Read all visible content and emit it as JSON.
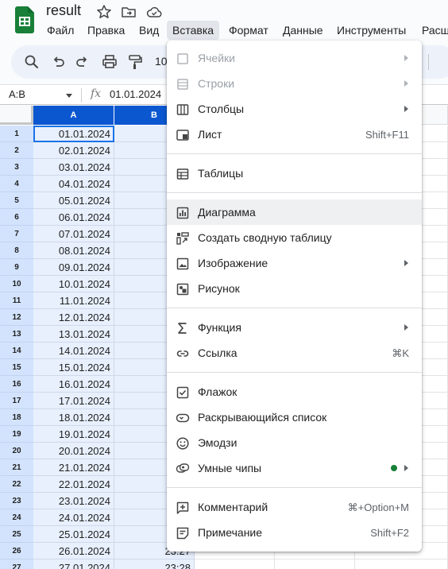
{
  "app": {
    "title": "result",
    "brand_color": "#188038"
  },
  "menubar": {
    "items": [
      {
        "label": "Файл"
      },
      {
        "label": "Правка"
      },
      {
        "label": "Вид"
      },
      {
        "label": "Вставка",
        "active": true
      },
      {
        "label": "Формат"
      },
      {
        "label": "Данные"
      },
      {
        "label": "Инструменты"
      },
      {
        "label": "Расш"
      }
    ]
  },
  "toolbar": {
    "icons": [
      "search-icon",
      "undo-icon",
      "redo-icon",
      "print-icon",
      "paint-format-icon"
    ],
    "zoom_text": "10"
  },
  "formula_bar": {
    "name_box": "A:B",
    "fx_label": "fx",
    "value": "01.01.2024"
  },
  "grid": {
    "selected_columns": [
      {
        "label": "A"
      },
      {
        "label": "B"
      }
    ],
    "rows": [
      {
        "num": "1",
        "a": "01.01.2024",
        "b": ""
      },
      {
        "num": "2",
        "a": "02.01.2024",
        "b": ""
      },
      {
        "num": "3",
        "a": "03.01.2024",
        "b": ""
      },
      {
        "num": "4",
        "a": "04.01.2024",
        "b": ""
      },
      {
        "num": "5",
        "a": "05.01.2024",
        "b": ""
      },
      {
        "num": "6",
        "a": "06.01.2024",
        "b": ""
      },
      {
        "num": "7",
        "a": "07.01.2024",
        "b": ""
      },
      {
        "num": "8",
        "a": "08.01.2024",
        "b": ""
      },
      {
        "num": "9",
        "a": "09.01.2024",
        "b": ""
      },
      {
        "num": "10",
        "a": "10.01.2024",
        "b": ""
      },
      {
        "num": "11",
        "a": "11.01.2024",
        "b": ""
      },
      {
        "num": "12",
        "a": "12.01.2024",
        "b": ""
      },
      {
        "num": "13",
        "a": "13.01.2024",
        "b": ""
      },
      {
        "num": "14",
        "a": "14.01.2024",
        "b": ""
      },
      {
        "num": "15",
        "a": "15.01.2024",
        "b": ""
      },
      {
        "num": "16",
        "a": "16.01.2024",
        "b": ""
      },
      {
        "num": "17",
        "a": "17.01.2024",
        "b": ""
      },
      {
        "num": "18",
        "a": "18.01.2024",
        "b": ""
      },
      {
        "num": "19",
        "a": "19.01.2024",
        "b": ""
      },
      {
        "num": "20",
        "a": "20.01.2024",
        "b": ""
      },
      {
        "num": "21",
        "a": "21.01.2024",
        "b": ""
      },
      {
        "num": "22",
        "a": "22.01.2024",
        "b": ""
      },
      {
        "num": "23",
        "a": "23.01.2024",
        "b": ""
      },
      {
        "num": "24",
        "a": "24.01.2024",
        "b": ""
      },
      {
        "num": "25",
        "a": "25.01.2024",
        "b": ""
      },
      {
        "num": "26",
        "a": "26.01.2024",
        "b": "23:27"
      },
      {
        "num": "27",
        "a": "27.01.2024",
        "b": "23:28"
      }
    ]
  },
  "insert_menu": {
    "groups": [
      [
        {
          "label": "Ячейки",
          "icon": "cells-icon",
          "disabled": true,
          "submenu": true
        },
        {
          "label": "Строки",
          "icon": "rows-icon",
          "disabled": true,
          "submenu": true
        },
        {
          "label": "Столбцы",
          "icon": "columns-icon",
          "submenu": true
        },
        {
          "label": "Лист",
          "icon": "sheet-icon",
          "shortcut": "Shift+F11"
        }
      ],
      [
        {
          "label": "Таблицы",
          "icon": "table-icon"
        }
      ],
      [
        {
          "label": "Диаграмма",
          "icon": "chart-icon",
          "hover": true
        },
        {
          "label": "Создать сводную таблицу",
          "icon": "pivot-table-icon"
        },
        {
          "label": "Изображение",
          "icon": "image-icon",
          "submenu": true
        },
        {
          "label": "Рисунок",
          "icon": "drawing-icon"
        }
      ],
      [
        {
          "label": "Функция",
          "icon": "sigma-icon",
          "submenu": true
        },
        {
          "label": "Ссылка",
          "icon": "link-icon",
          "shortcut": "⌘K"
        }
      ],
      [
        {
          "label": "Флажок",
          "icon": "checkbox-icon"
        },
        {
          "label": "Раскрывающийся список",
          "icon": "dropdown-list-icon"
        },
        {
          "label": "Эмодзи",
          "icon": "emoji-icon"
        },
        {
          "label": "Умные чипы",
          "icon": "smart-chips-icon",
          "submenu": true,
          "new_dot": true
        }
      ],
      [
        {
          "label": "Комментарий",
          "icon": "comment-icon",
          "shortcut": "⌘+Option+M"
        },
        {
          "label": "Примечание",
          "icon": "note-icon",
          "shortcut": "Shift+F2"
        }
      ]
    ]
  }
}
